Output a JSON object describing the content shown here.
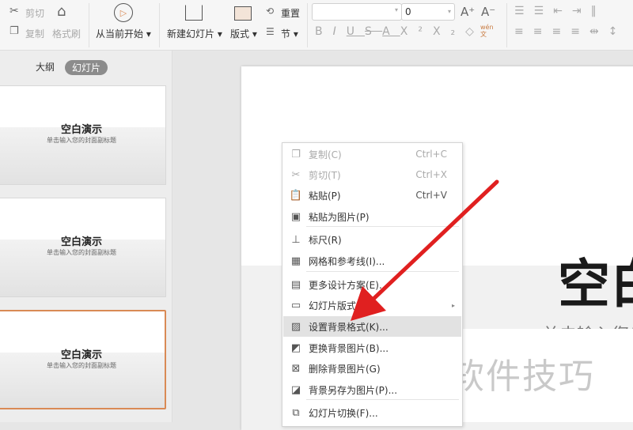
{
  "ribbon": {
    "cut": "剪切",
    "copy": "复制",
    "format_painter": "格式刷",
    "from_current": "从当前开始",
    "new_slide": "新建幻灯片",
    "layout": "版式",
    "reset": "重置",
    "section": "节",
    "font_name": "",
    "font_size": "0",
    "phonetic": "wén\n文"
  },
  "panel": {
    "tabs": [
      "大纲",
      "幻灯片"
    ],
    "active_tab": 1
  },
  "thumbnails": [
    {
      "title": "空白演示",
      "subtitle": "单击输入您的封面副标题",
      "selected": false
    },
    {
      "title": "空白演示",
      "subtitle": "单击输入您的封面副标题",
      "selected": false
    },
    {
      "title": "空白演示",
      "subtitle": "单击输入您的封面副标题",
      "selected": true
    }
  ],
  "slide": {
    "title": "空白演示",
    "subtitle": "单击输入您的封面副标题"
  },
  "watermark": "软件技巧",
  "context_menu": [
    {
      "label": "复制(C)",
      "shortcut": "Ctrl+C",
      "icon": "copy-icon",
      "disabled": true
    },
    {
      "label": "剪切(T)",
      "shortcut": "Ctrl+X",
      "icon": "cut-icon",
      "disabled": true
    },
    {
      "label": "粘贴(P)",
      "shortcut": "Ctrl+V",
      "icon": "paste-icon"
    },
    {
      "label": "粘贴为图片(P)",
      "shortcut": "",
      "icon": "paste-image-icon"
    },
    {
      "label": "标尺(R)",
      "shortcut": "",
      "icon": "ruler-icon"
    },
    {
      "label": "网格和参考线(I)...",
      "shortcut": "",
      "icon": "grid-icon"
    },
    {
      "label": "更多设计方案(E)...",
      "shortcut": "",
      "icon": "design-icon"
    },
    {
      "label": "幻灯片版式(L)",
      "shortcut": "",
      "icon": "layout-icon",
      "submenu": true
    },
    {
      "label": "设置背景格式(K)...",
      "shortcut": "",
      "icon": "background-format-icon",
      "highlighted": true
    },
    {
      "label": "更换背景图片(B)...",
      "shortcut": "",
      "icon": "change-background-icon"
    },
    {
      "label": "删除背景图片(G)",
      "shortcut": "",
      "icon": "delete-background-icon"
    },
    {
      "label": "背景另存为图片(P)...",
      "shortcut": "",
      "icon": "save-background-icon"
    },
    {
      "label": "幻灯片切换(F)...",
      "shortcut": "",
      "icon": "transition-icon"
    }
  ],
  "colors": {
    "accent": "#d98a55",
    "arrow": "#e02020"
  }
}
